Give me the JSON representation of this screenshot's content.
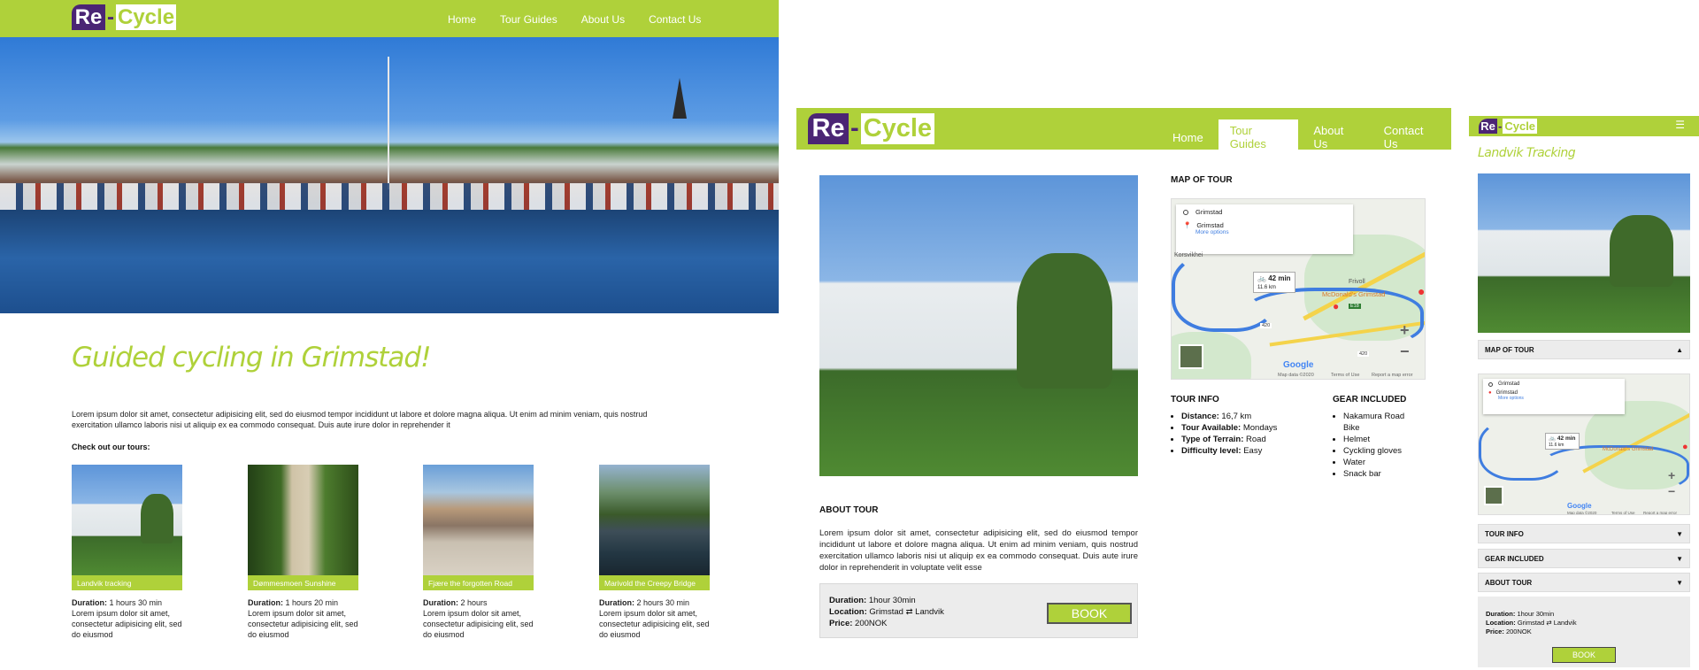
{
  "brand": {
    "re": "Re",
    "dash": "-",
    "cycle": "Cycle",
    "green": "#afd13a",
    "purple": "#4b2574"
  },
  "home": {
    "nav": [
      "Home",
      "Tour Guides",
      "About Us",
      "Contact Us"
    ],
    "heading": "Guided cycling in Grimstad!",
    "lead": "Lorem ipsum dolor sit amet, consectetur adipisicing elit, sed do eiusmod tempor incididunt ut labore et dolore magna aliqua. Ut enim ad minim veniam, quis nostrud exercitation ullamco laboris nisi ut aliquip ex ea commodo consequat. Duis aute irure dolor in reprehender it",
    "check_label": "Check out our tours:",
    "duration_label": "Duration:",
    "tours": [
      {
        "name": "Landvik tracking",
        "duration": "1 hours 30 min",
        "desc": "Lorem ipsum dolor sit amet, consectetur adipisicing elit, sed do eiusmod"
      },
      {
        "name": "Dømmesmoen Sunshine",
        "duration": "1 hours 20 min",
        "desc": "Lorem ipsum dolor sit amet, consectetur adipisicing elit, sed do eiusmod"
      },
      {
        "name": "Fjære the forgotten Road",
        "duration": "2 hours",
        "desc": "Lorem ipsum dolor sit amet, consectetur adipisicing elit, sed do eiusmod"
      },
      {
        "name": "Marivold the Creepy Bridge",
        "duration": "2 hours 30 min",
        "desc": "Lorem ipsum dolor sit amet, consectetur adipisicing elit, sed do eiusmod"
      }
    ]
  },
  "tour": {
    "nav": [
      "Home",
      "Tour Guides",
      "About Us",
      "Contact Us"
    ],
    "active_nav": "Tour Guides",
    "map_heading": "MAP OF TOUR",
    "map": {
      "from": "Grimstad",
      "to": "Grimstad",
      "more": "More options",
      "time": "42 min",
      "distance": "11.6 km",
      "place": "McDonald's Grimstad",
      "area": "Korsvikhei",
      "area2": "Frivoll",
      "road1": "420",
      "road2": "E18",
      "road3": "420",
      "google": "Google",
      "footer1": "Map data ©2020",
      "footer2": "Terms of Use",
      "footer3": "Report a map error",
      "zoom_in": "+",
      "zoom_out": "−"
    },
    "tour_info_heading": "TOUR INFO",
    "info": [
      {
        "label": "Distance:",
        "value": "16,7 km"
      },
      {
        "label": "Tour Available:",
        "value": "Mondays"
      },
      {
        "label": "Type of Terrain:",
        "value": "Road"
      },
      {
        "label": "Difficulty level:",
        "value": "Easy"
      }
    ],
    "gear_heading": "GEAR INCLUDED",
    "gear": [
      "Nakamura Road Bike",
      "Helmet",
      "Cyckling gloves",
      "Water",
      "Snack bar"
    ],
    "about_heading": "ABOUT TOUR",
    "about_text": "Lorem ipsum dolor sit amet, consectetur adipisicing elit, sed do eiusmod tempor incididunt ut labore et dolore magna aliqua. Ut enim ad minim veniam, quis nostrud exercitation ullamco laboris nisi ut aliquip ex ea commodo consequat. Duis aute irure dolor in reprehenderit in voluptate velit esse",
    "duration_label": "Duration:",
    "duration": "1hour 30min",
    "location_label": "Location:",
    "location": "Grimstad ⇄ Landvik",
    "price_label": "Price:",
    "price": "200NOK",
    "book": "BOOK"
  },
  "mobile": {
    "menu_icon": "☰",
    "title": "Landvik Tracking",
    "sections": [
      {
        "label": "MAP OF TOUR",
        "icon": "▲"
      },
      {
        "label": "TOUR INFO",
        "icon": "▼"
      },
      {
        "label": "GEAR INCLUDED",
        "icon": "▼"
      },
      {
        "label": "ABOUT TOUR",
        "icon": "▼"
      }
    ],
    "duration_label": "Duration:",
    "duration": "1hour 30min",
    "location_label": "Location:",
    "location": "Grimstad ⇄ Landvik",
    "price_label": "Price:",
    "price": "200NOK",
    "book": "BOOK"
  }
}
